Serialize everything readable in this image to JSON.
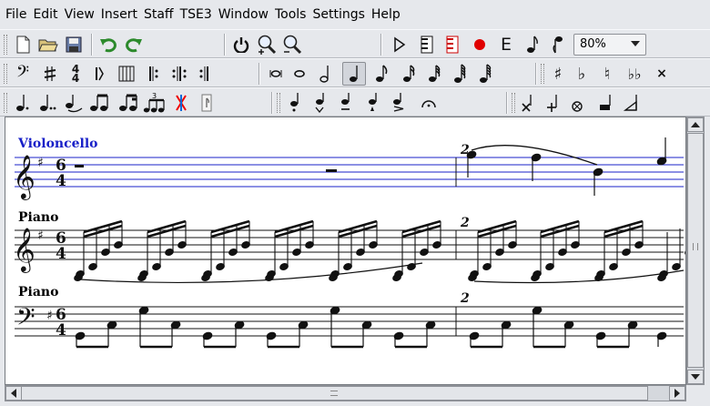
{
  "menubar": {
    "items": [
      "File",
      "Edit",
      "View",
      "Insert",
      "Staff",
      "TSE3",
      "Window",
      "Tools",
      "Settings",
      "Help"
    ]
  },
  "toolbar": {
    "zoom": "80%",
    "edit_symbol": "E",
    "tuplet_label": "3"
  },
  "score": {
    "staves": [
      "Violoncello",
      "Piano",
      "Piano"
    ],
    "measure_number": "2",
    "time_signature": [
      "6",
      "4"
    ]
  },
  "colors": {
    "instrument_label": "#1820c8",
    "staff_selected": "#1820c8",
    "record": "#e00000"
  }
}
